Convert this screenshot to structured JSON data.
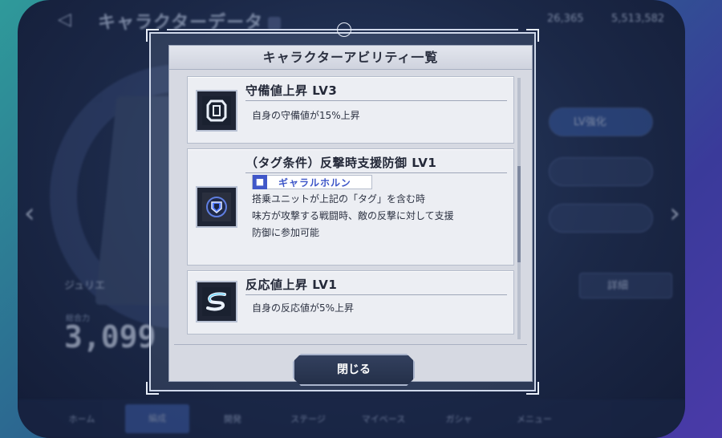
{
  "background": {
    "title": "キャラクターデータ",
    "currency_1": "26,365",
    "currency_2": "5,513,582",
    "lv_button": "LV強化",
    "detail_button": "詳細",
    "character_name": "ジュリエ",
    "stat_label": "総合力",
    "stat_value": "3,099",
    "nav": [
      "ホーム",
      "編成",
      "開発",
      "ステージ",
      "マイベース",
      "ガシャ",
      "メニュー"
    ]
  },
  "dialog": {
    "title": "キャラクターアビリティ一覧",
    "abilities": [
      {
        "title": "守備値上昇 LV3",
        "icon": "shield-badge-icon",
        "description": [
          "自身の守備値が15%上昇"
        ]
      },
      {
        "title": "（タグ条件）反撃時支援防御 LV1",
        "icon": "support-defense-icon",
        "tag": "ギャラルホルン",
        "tag_icon": "robot-icon",
        "description": [
          "搭乗ユニットが上記の「タグ」を含む時",
          "味方が攻撃する戦闘時、敵の反撃に対して支援",
          "防御に参加可能"
        ]
      },
      {
        "title": "反応値上昇 LV1",
        "icon": "reaction-swoosh-icon",
        "description": [
          "自身の反応値が5%上昇"
        ]
      }
    ],
    "close_label": "閉じる"
  }
}
